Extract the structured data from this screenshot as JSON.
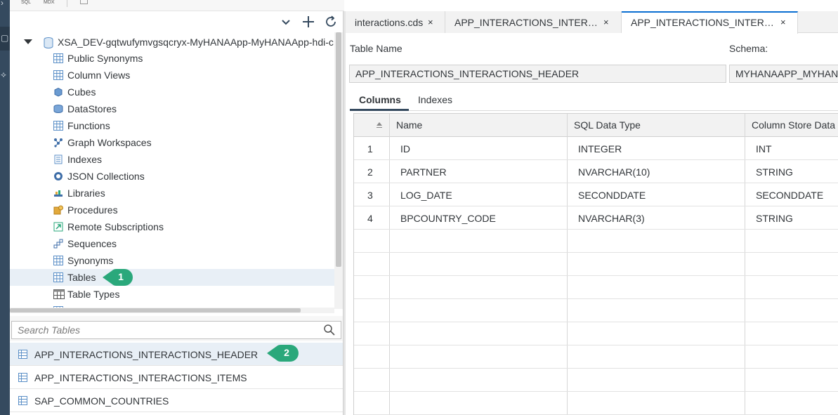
{
  "toolbar": {
    "sql_label": "SQL",
    "mdx_label": "MDX"
  },
  "tree": {
    "root_label": "XSA_DEV-gqtwufymvgsqcryx-MyHANAApp-MyHANAApp-hdi-c",
    "items": [
      {
        "label": "Public Synonyms",
        "icon": "public-synonym-icon"
      },
      {
        "label": "Column Views",
        "icon": "column-view-icon"
      },
      {
        "label": "Cubes",
        "icon": "cube-icon"
      },
      {
        "label": "DataStores",
        "icon": "datastore-icon"
      },
      {
        "label": "Functions",
        "icon": "function-icon"
      },
      {
        "label": "Graph Workspaces",
        "icon": "graph-workspace-icon"
      },
      {
        "label": "Indexes",
        "icon": "index-icon"
      },
      {
        "label": "JSON Collections",
        "icon": "json-collection-icon"
      },
      {
        "label": "Libraries",
        "icon": "library-icon"
      },
      {
        "label": "Procedures",
        "icon": "procedure-icon"
      },
      {
        "label": "Remote Subscriptions",
        "icon": "remote-subscription-icon"
      },
      {
        "label": "Sequences",
        "icon": "sequence-icon"
      },
      {
        "label": "Synonyms",
        "icon": "synonym-icon"
      },
      {
        "label": "Tables",
        "icon": "table-icon"
      },
      {
        "label": "Table Types",
        "icon": "table-type-icon"
      },
      {
        "label": "Tr",
        "icon": "trigger-icon"
      }
    ]
  },
  "callouts": {
    "one": "1",
    "two": "2",
    "color": "#2aa87b"
  },
  "search": {
    "placeholder": "Search Tables"
  },
  "results": [
    {
      "label": "APP_INTERACTIONS_INTERACTIONS_HEADER"
    },
    {
      "label": "APP_INTERACTIONS_INTERACTIONS_ITEMS"
    },
    {
      "label": "SAP_COMMON_COUNTRIES"
    }
  ],
  "editor": {
    "tabs": [
      {
        "label": "interactions.cds",
        "close": "×"
      },
      {
        "label": "APP_INTERACTIONS_INTER…",
        "close": "×"
      },
      {
        "label": "APP_INTERACTIONS_INTER…",
        "close": "×"
      }
    ],
    "table_name_label": "Table Name",
    "table_name_value": "APP_INTERACTIONS_INTERACTIONS_HEADER",
    "schema_label": "Schema:",
    "schema_value": "MYHANAAPP_MYHAN",
    "subtabs": [
      "Columns",
      "Indexes"
    ],
    "grid": {
      "headers": [
        "Name",
        "SQL Data Type",
        "Column Store Data T"
      ],
      "rows": [
        {
          "num": "1",
          "name": "ID",
          "sql_type": "INTEGER",
          "cs_type": "INT"
        },
        {
          "num": "2",
          "name": "PARTNER",
          "sql_type": "NVARCHAR(10)",
          "cs_type": "STRING"
        },
        {
          "num": "3",
          "name": "LOG_DATE",
          "sql_type": "SECONDDATE",
          "cs_type": "SECONDDATE"
        },
        {
          "num": "4",
          "name": "BPCOUNTRY_CODE",
          "sql_type": "NVARCHAR(3)",
          "cs_type": "STRING"
        }
      ]
    }
  },
  "colors": {
    "accent": "#0a6ed1",
    "sidebar": "#354a5f",
    "selection": "#e8eff6"
  }
}
